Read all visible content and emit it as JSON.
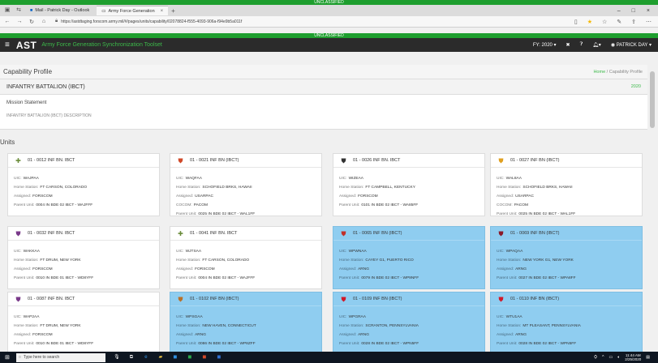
{
  "classification": "UNCLASSIFIED",
  "browser": {
    "tab_mail": "Mail - Patrick Day - Outlook",
    "tab_active": "Army Force Generation",
    "url": "https://astdtaging.forscom.army.mil/#/pages/units/capability/02078824-f555-4093-906a-f94e9b5a011f",
    "tab_close": "×",
    "new_tab": "+",
    "win_min": "–",
    "win_max": "□",
    "win_close": "×"
  },
  "app": {
    "logo": "AST",
    "title": "Army Force Generation Synchronization Toolset",
    "fy": "FY: 2020 ▾",
    "user": "PATRICK DAY ▾"
  },
  "page": {
    "title": "Capability Profile",
    "breadcrumb_home": "Home",
    "breadcrumb_sep": "/",
    "breadcrumb_current": "Capability Profile"
  },
  "profile": {
    "name": "INFANTRY BATTALION (IBCT)",
    "year": "2020",
    "mission_label": "Mission Statement",
    "mission_desc": "INFANTRY BATTALION (IBCT) DESCRIPTION"
  },
  "units_title": "Units",
  "labels": {
    "uic": "UIC:",
    "home_station": "Home Station:",
    "assigned": "Assigned:",
    "cocom": "COCOM:",
    "parent_unit": "Parent Unit:"
  },
  "units": [
    {
      "title": "01 - 0012 INF BN. IBCT",
      "icon": "crossed-rifles-icon",
      "icon_color": "#6a8c3a",
      "highlight": false,
      "uic": "WAJPAA",
      "home": "FT CARSON, COLORADO",
      "assigned": "FORSCOM",
      "cocom": "",
      "parent": "0004 IN BDE 02 IBCT - WAJFFF"
    },
    {
      "title": "01 - 0021 INF BN (IBCT)",
      "icon": "shield-crest-icon",
      "icon_color": "#d04a2a",
      "highlight": false,
      "uic": "WAQFAA",
      "home": "SCHOFIELD BRKS, HAWAII",
      "assigned": "USARPAC",
      "cocom": "PACOM",
      "parent": "0025 IN BDE 02 IBCT - WAL1FF"
    },
    {
      "title": "01 - 0026 INF BN. IBCT",
      "icon": "shield-crest-icon",
      "icon_color": "#333333",
      "highlight": false,
      "uic": "WIZEAA",
      "home": "FT CAMPBELL, KENTUCKY",
      "assigned": "FORSCOM",
      "cocom": "",
      "parent": "0101 IN BDE 02 IBCT - WA85FF"
    },
    {
      "title": "01 - 0027 INF BN (IBCT)",
      "icon": "shield-crest-icon",
      "icon_color": "#e0a020",
      "highlight": false,
      "uic": "WAL8AA",
      "home": "SCHOFIELD BRKS, HAWAII",
      "assigned": "USARPAC",
      "cocom": "PACOM",
      "parent": "0025 IN BDE 02 IBCT - WAL1FF"
    },
    {
      "title": "01 - 0032 INF BN. IBCT",
      "icon": "shield-crest-icon",
      "icon_color": "#7a3a8a",
      "highlight": false,
      "uic": "WAKKAA",
      "home": "FT DRUM, NEW YORK",
      "assigned": "FORSCOM",
      "cocom": "",
      "parent": "0010 IN BDE 01 IBCT - WD8YFF"
    },
    {
      "title": "01 - 0041 INF BN. IBCT",
      "icon": "crossed-rifles-icon",
      "icon_color": "#6a8c3a",
      "highlight": false,
      "uic": "WJTSAA",
      "home": "FT CARSON, COLORADO",
      "assigned": "FORSCOM",
      "cocom": "",
      "parent": "0004 IN BDE 02 IBCT - WAJFFF"
    },
    {
      "title": "01 - 0065 INF BN (IBCT)",
      "icon": "shield-crest-icon",
      "icon_color": "#c0302a",
      "highlight": true,
      "uic": "WPWNAA",
      "home": "CAYEY G1, PUERTO RICO",
      "assigned": "ARNG",
      "cocom": "",
      "parent": "0079 IN BDE 02 IBCT - WP9NFF"
    },
    {
      "title": "01 - 0069 INF BN (IBCT)",
      "icon": "shield-crest-icon",
      "icon_color": "#8a1a2a",
      "highlight": true,
      "uic": "WPAQAA",
      "home": "NEW YORK G1, NEW YORK",
      "assigned": "ARNG",
      "cocom": "",
      "parent": "0027 IN BDE 02 IBCT - WPA8FF"
    },
    {
      "title": "01 - 0087 INF BN. IBCT",
      "icon": "shield-crest-icon",
      "icon_color": "#7a3a8a",
      "highlight": false,
      "uic": "WAP2AA",
      "home": "FT DRUM, NEW YORK",
      "assigned": "FORSCOM",
      "cocom": "",
      "parent": "0010 IN BDE 01 IBCT - WD8YFF"
    },
    {
      "title": "01 - 0102 INF BN (IBCT)",
      "icon": "shield-crest-icon",
      "icon_color": "#b8702a",
      "highlight": true,
      "uic": "WPSGAA",
      "home": "NEW HAVEN, CONNECTICUT",
      "assigned": "ARNG",
      "cocom": "",
      "parent": "0086 IN BDE 02 IBCT - WP8ZFF"
    },
    {
      "title": "01 - 0109 INF BN (IBCT)",
      "icon": "shield-crest-icon",
      "icon_color": "#d01a2a",
      "highlight": true,
      "uic": "WPGRAA",
      "home": "SCRANTON, PENNSYLVANIA",
      "assigned": "ARNG",
      "cocom": "",
      "parent": "0028 IN BDE 02 IBCT - WPN5FF"
    },
    {
      "title": "01 - 0110 INF BN (IBCT)",
      "icon": "shield-crest-icon",
      "icon_color": "#d01a2a",
      "highlight": true,
      "uic": "WTU1AA",
      "home": "MT PLEASANT, PENNSYLVANIA",
      "assigned": "ARNG",
      "cocom": "",
      "parent": "0028 IN BDE 02 IBCT - WPN5FF"
    }
  ],
  "taskbar": {
    "search_placeholder": "Type here to search",
    "time": "11:44 AM",
    "date": "2/25/2020"
  }
}
